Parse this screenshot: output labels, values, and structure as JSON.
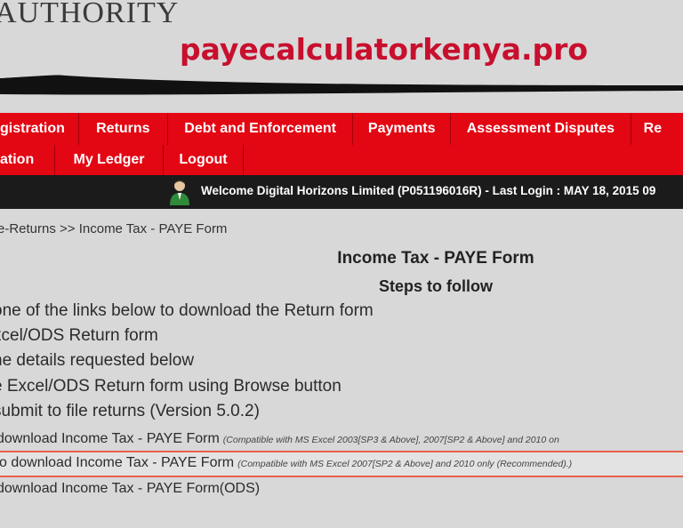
{
  "header": {
    "logo_text": "AUTHORITY",
    "watermark": "payecalculatorkenya.pro"
  },
  "nav": {
    "row1": [
      "gistration",
      "Returns",
      "Debt and Enforcement",
      "Payments",
      "Assessment Disputes",
      "Re"
    ],
    "row2": [
      "ation",
      "My Ledger",
      "Logout"
    ]
  },
  "welcome": {
    "text": "Welcome Digital Horizons Limited (P051196016R)  - Last Login : MAY 18, 2015 09"
  },
  "breadcrumb": "e-Returns >> Income Tax - PAYE Form",
  "page": {
    "title": "Income Tax - PAYE Form",
    "steps_title": "Steps to follow"
  },
  "steps": [
    "one of the links below to download the Return form",
    "xcel/ODS Return form",
    "he details requested below",
    "e Excel/ODS Return form using Browse button",
    "submit to file returns (Version 5.0.2)"
  ],
  "downloads": [
    {
      "link": "download Income Tax - PAYE Form",
      "note": "(Compatible with MS Excel 2003[SP3 & Above], 2007[SP2 & Above] and 2010 on"
    },
    {
      "link": "o download Income Tax - PAYE Form",
      "note": "(Compatible with MS Excel 2007[SP2 & Above] and 2010 only (Recommended).)"
    },
    {
      "link": "download Income Tax - PAYE Form(ODS)",
      "note": ""
    }
  ],
  "colors": {
    "nav_red": "#e30613",
    "watermark_red": "#c8102e",
    "highlight_border": "#e8604c"
  }
}
